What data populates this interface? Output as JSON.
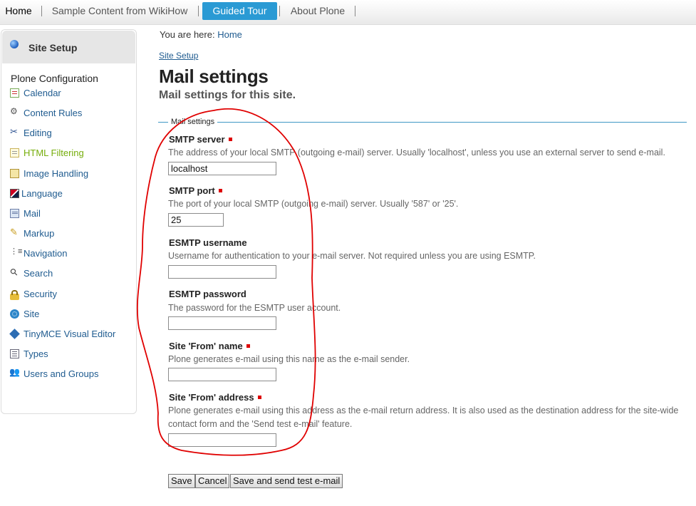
{
  "topnav": {
    "tabs": [
      {
        "label": "Home"
      },
      {
        "label": "Sample Content from WikiHow"
      },
      {
        "label": "Guided Tour"
      },
      {
        "label": "About Plone"
      }
    ]
  },
  "sidebar": {
    "header": "Site Setup",
    "section": "Plone Configuration",
    "items": [
      {
        "label": "Calendar",
        "icon": "calendar-icon"
      },
      {
        "label": "Content Rules",
        "icon": "content-rules-icon"
      },
      {
        "label": "Editing",
        "icon": "scissors-icon"
      },
      {
        "label": "HTML Filtering",
        "icon": "document-icon"
      },
      {
        "label": "Image Handling",
        "icon": "image-icon"
      },
      {
        "label": "Language",
        "icon": "flag-icon"
      },
      {
        "label": "Mail",
        "icon": "mail-icon"
      },
      {
        "label": "Markup",
        "icon": "pencil-icon"
      },
      {
        "label": "Navigation",
        "icon": "navigation-tree-icon"
      },
      {
        "label": "Search",
        "icon": "magnifier-icon"
      },
      {
        "label": "Security",
        "icon": "lock-icon"
      },
      {
        "label": "Site",
        "icon": "site-icon"
      },
      {
        "label": "TinyMCE Visual Editor",
        "icon": "tinymce-icon"
      },
      {
        "label": "Types",
        "icon": "types-icon"
      },
      {
        "label": "Users and Groups",
        "icon": "users-icon"
      }
    ],
    "active_color": "#75ad0a"
  },
  "breadcrumb": {
    "prefix": "You are here:",
    "home": "Home"
  },
  "main": {
    "up_link": "Site Setup",
    "title": "Mail settings",
    "description": "Mail settings for this site.",
    "fieldset_legend": "Mail settings",
    "fields": [
      {
        "label": "SMTP server",
        "required": true,
        "help": "The address of your local SMTP (outgoing e-mail) server. Usually 'localhost', unless you use an external server to send e-mail.",
        "value": "localhost"
      },
      {
        "label": "SMTP port",
        "required": true,
        "help": "The port of your local SMTP (outgoing e-mail) server. Usually '587' or '25'.",
        "value": "25"
      },
      {
        "label": "ESMTP username",
        "required": false,
        "help": "Username for authentication to your e-mail server. Not required unless you are using ESMTP.",
        "value": ""
      },
      {
        "label": "ESMTP password",
        "required": false,
        "help": "The password for the ESMTP user account.",
        "value": ""
      },
      {
        "label": "Site 'From' name",
        "required": true,
        "help": "Plone generates e-mail using this name as the e-mail sender.",
        "value": ""
      },
      {
        "label": "Site 'From' address",
        "required": true,
        "help": "Plone generates e-mail using this address as the e-mail return address. It is also used as the destination address for the site-wide contact form and the 'Send test e-mail' feature.",
        "value": ""
      }
    ],
    "buttons": {
      "save": "Save",
      "cancel": "Cancel",
      "save_test": "Save and send test e-mail"
    }
  },
  "colors": {
    "accent": "#2a9ad4",
    "link": "#205c90",
    "annotation": "#e00000",
    "required": "#dd0000"
  }
}
